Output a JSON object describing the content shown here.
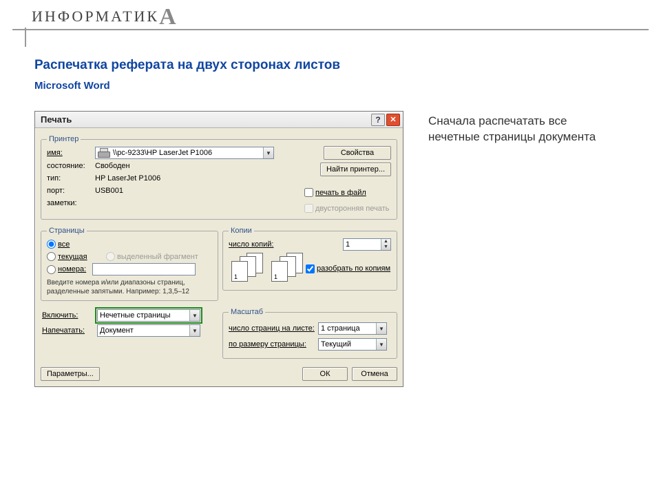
{
  "page": {
    "brand_prefix": "ИНФОРМАТИК",
    "brand_suffix": "А",
    "title": "Распечатка реферата на двух сторонах листов",
    "subtitle": "Microsoft Word",
    "side_note": "Сначала распечатать все нечетные страницы документа"
  },
  "dialog": {
    "title": "Печать",
    "help_glyph": "?",
    "close_glyph": "✕",
    "printer": {
      "legend": "Принтер",
      "name_label": "имя:",
      "name_value": "\\\\pc-9233\\HP LaserJet P1006",
      "status_label": "состояние:",
      "status_value": "Свободен",
      "type_label": "тип:",
      "type_value": "HP LaserJet P1006",
      "port_label": "порт:",
      "port_value": "USB001",
      "notes_label": "заметки:",
      "btn_props": "Свойства",
      "btn_find": "Найти принтер...",
      "chk_to_file": "печать в файл",
      "chk_duplex": "двусторонняя печать"
    },
    "pages": {
      "legend": "Страницы",
      "opt_all": "все",
      "opt_current": "текущая",
      "opt_selection": "выделенный фрагмент",
      "opt_numbers": "номера:",
      "help1": "Введите номера и/или диапазоны страниц,",
      "help2": "разделенные запятыми. Например: 1,3,5–12"
    },
    "copies": {
      "legend": "Копии",
      "count_label": "число копий:",
      "count_value": "1",
      "collate": "разобрать по копиям",
      "sheet_label_a": "1",
      "sheet_label_b": "1"
    },
    "include_label": "Включить:",
    "include_value": "Нечетные страницы",
    "print_what_label": "Напечатать:",
    "print_what_value": "Документ",
    "scale": {
      "legend": "Масштаб",
      "pps_label": "число страниц на листе:",
      "pps_value": "1 страница",
      "fit_label": "по размеру страницы:",
      "fit_value": "Текущий"
    },
    "btn_params": "Параметры...",
    "btn_ok": "ОК",
    "btn_cancel": "Отмена"
  }
}
